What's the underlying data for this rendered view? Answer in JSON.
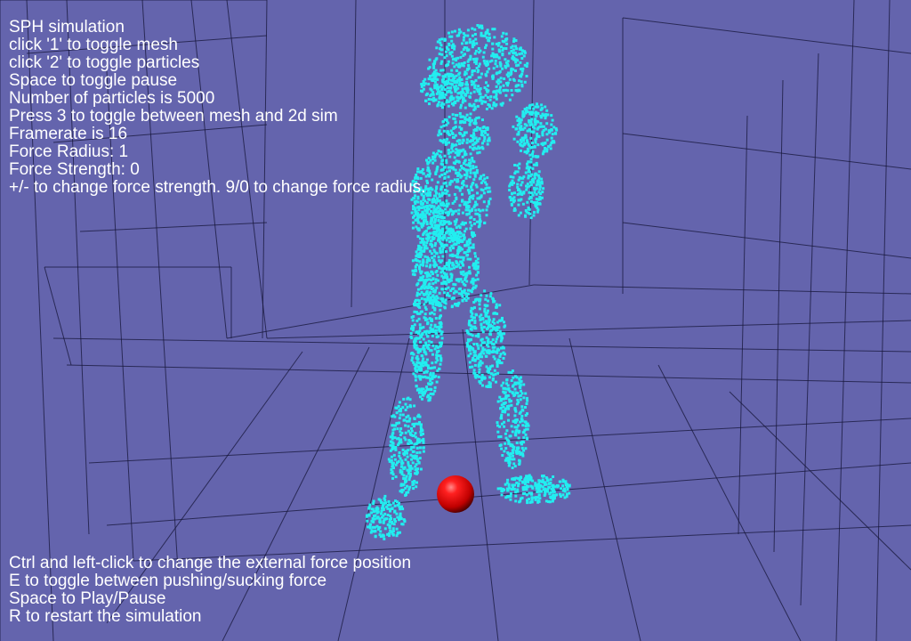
{
  "colors": {
    "background": "#6464ad",
    "grid_line": "#16163a",
    "particle": "#22eef0",
    "force_sphere": "#e8141a",
    "text": "#ffffff"
  },
  "scene": {
    "number_of_particles": 5000,
    "force_sphere_icon": "red-sphere",
    "particle_figure": "fluid-humanoid-figure"
  },
  "hud_top": [
    "SPH simulation",
    "click '1' to toggle mesh",
    "click '2' to toggle particles",
    "Space to toggle pause",
    "Number of particles is 5000",
    "Press 3 to toggle between mesh and 2d sim",
    "Framerate is 16",
    "Force Radius: 1",
    "Force Strength: 0",
    "+/- to change force strength. 9/0 to change force radius."
  ],
  "hud_bottom": [
    "Ctrl and left-click to change the external force position",
    "E to toggle between pushing/sucking force",
    "Space to Play/Pause",
    "R to restart the simulation"
  ]
}
